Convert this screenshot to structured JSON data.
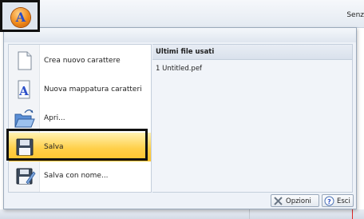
{
  "window": {
    "doc_title": "Senz"
  },
  "app_button": {
    "glyph": "A"
  },
  "menu": {
    "items": [
      {
        "label": "Crea nuovo carattere",
        "icon": "new-document-icon",
        "active": false
      },
      {
        "label": "Nuova mappatura caratteri",
        "icon": "font-mapping-icon",
        "active": false
      },
      {
        "label": "Apri...",
        "icon": "open-folder-icon",
        "active": false
      },
      {
        "label": "Salva",
        "icon": "save-disk-icon",
        "active": true
      },
      {
        "label": "Salva con nome...",
        "icon": "save-as-icon",
        "active": false
      }
    ],
    "recent": {
      "header": "Ultimi file usati",
      "files": [
        "1 Untitled.pef"
      ]
    },
    "buttons": {
      "options": "Opzioni",
      "exit": "Esci"
    }
  },
  "colors": {
    "highlight": "#ffd04a",
    "accent_orange": "#f08b1c",
    "menu_bg": "#eef2f8"
  }
}
